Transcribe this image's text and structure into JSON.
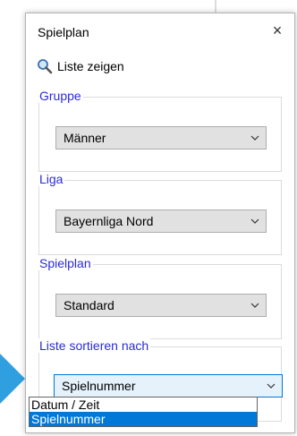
{
  "window": {
    "title": "Spielplan",
    "close_glyph": "×"
  },
  "toolbar": {
    "show_list_label": "Liste zeigen",
    "show_list_icon": "magnifier-icon"
  },
  "groups": {
    "gruppe": {
      "legend": "Gruppe",
      "value": "Männer"
    },
    "liga": {
      "legend": "Liga",
      "value": "Bayernliga Nord"
    },
    "spielplan": {
      "legend": "Spielplan",
      "value": "Standard"
    },
    "sort": {
      "legend": "Liste sortieren nach",
      "value": "Spielnummer"
    }
  },
  "sort_options": [
    "Datum / Zeit",
    "Spielnummer"
  ],
  "colors": {
    "legend": "#2b2bd6",
    "accent": "#0078d7",
    "arrow": "#2f9fe0"
  }
}
